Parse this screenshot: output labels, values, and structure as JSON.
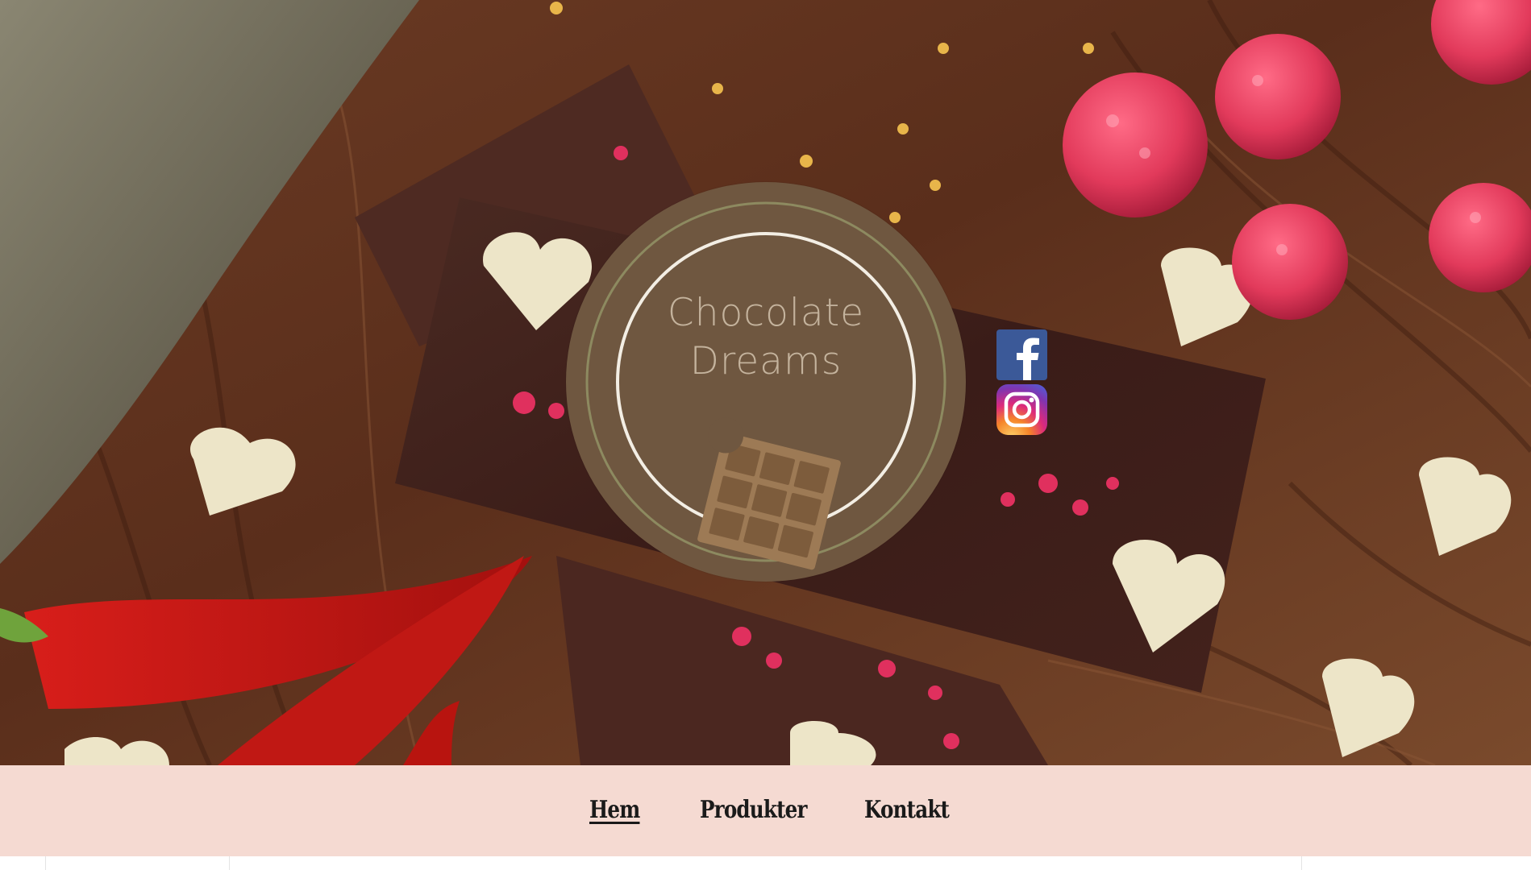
{
  "logo": {
    "line1": "Chocolate",
    "line2": "Dreams"
  },
  "social": {
    "facebook_label": "f"
  },
  "nav": {
    "items": [
      {
        "label": "Hem",
        "active": true
      },
      {
        "label": "Produkter",
        "active": false
      },
      {
        "label": "Kontakt",
        "active": false
      }
    ]
  },
  "colors": {
    "nav_background": "#f5dad2",
    "logo_background": "#6f5740",
    "logo_text": "#c4b39d",
    "facebook": "#3b5998"
  }
}
